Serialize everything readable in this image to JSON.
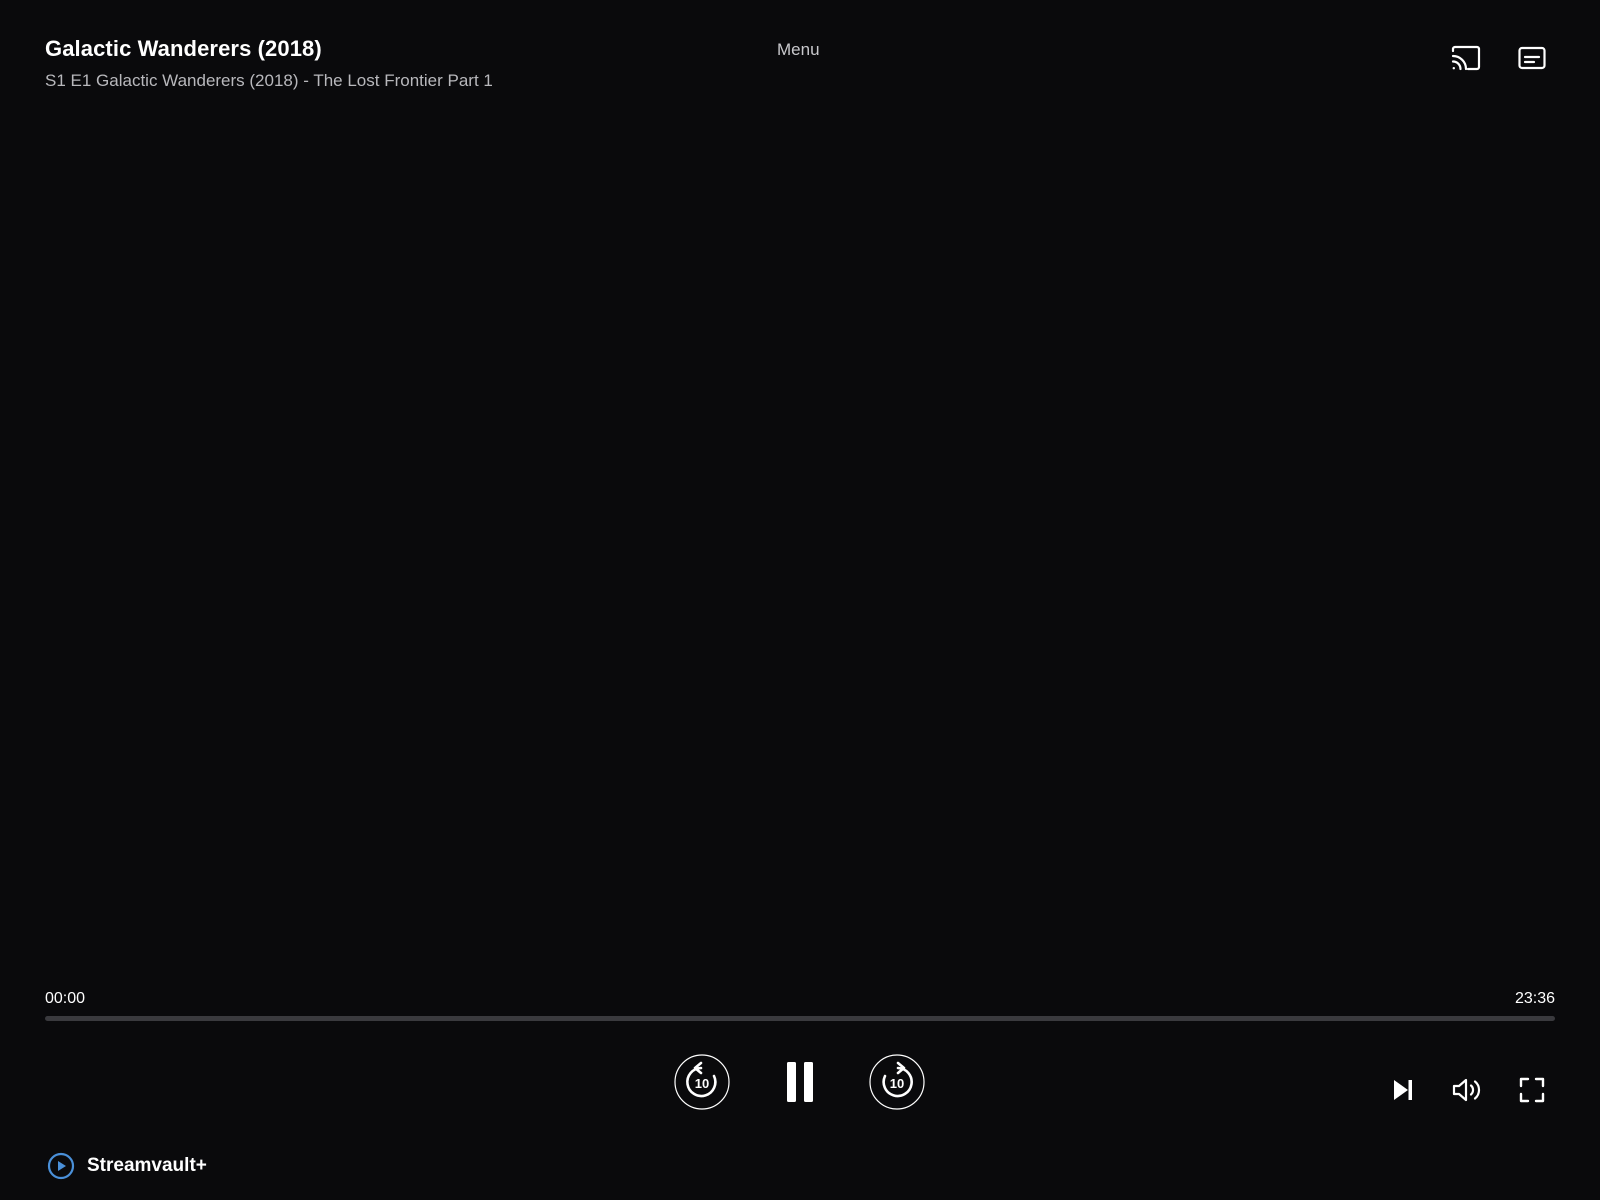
{
  "header": {
    "title": "Galactic Wanderers (2018)",
    "episode": "S1 E1 Galactic Wanderers (2018) - The Lost Frontier Part 1",
    "menu_label": "Menu",
    "icons": [
      "cast-icon",
      "subtitles-icon"
    ]
  },
  "playback": {
    "current_time": "00:00",
    "total_time": "23:36",
    "progress_fraction": 0,
    "skip_seconds": "10"
  },
  "controls": {
    "center": [
      "rewind-10-icon",
      "pause-icon",
      "forward-10-icon"
    ],
    "right": [
      "next-episode-icon",
      "volume-icon",
      "fullscreen-icon"
    ]
  },
  "brand": {
    "name": "Streamvault+",
    "accent_color": "#4a90d9"
  },
  "colors": {
    "background": "#0a0a0c",
    "progress_track": "#3a3a3e",
    "text_primary": "#ffffff",
    "text_secondary": "#b8b8bc"
  }
}
